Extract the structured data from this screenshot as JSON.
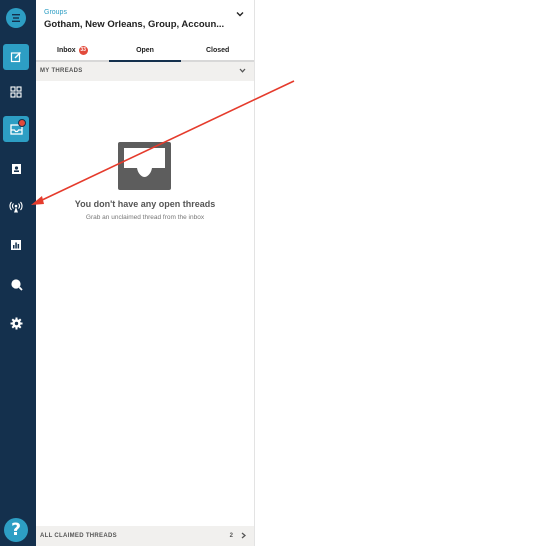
{
  "rail": {
    "items": [
      {
        "icon": "hamburger-icon",
        "active": false
      },
      {
        "icon": "compose-icon",
        "active": true
      },
      {
        "icon": "grid-icon",
        "active": false
      },
      {
        "icon": "inbox-icon",
        "active": true,
        "has_notification": true
      },
      {
        "icon": "contacts-icon",
        "active": false
      },
      {
        "icon": "broadcast-icon",
        "active": false
      },
      {
        "icon": "analytics-icon",
        "active": false
      },
      {
        "icon": "search-icon",
        "active": false
      },
      {
        "icon": "settings-icon",
        "active": false
      }
    ],
    "help_label": "?"
  },
  "header": {
    "label": "Groups",
    "title": "Gotham, New Orleans, Group, Accoun..."
  },
  "tabs": [
    {
      "label": "Inbox",
      "badge": "33",
      "active": false
    },
    {
      "label": "Open",
      "active": true
    },
    {
      "label": "Closed",
      "active": false
    }
  ],
  "my_threads": {
    "label": "MY THREADS"
  },
  "empty_state": {
    "title": "You don't have any open threads",
    "subtitle": "Grab an unclaimed thread from the inbox"
  },
  "footer": {
    "label": "ALL CLAIMED THREADS",
    "count": "2"
  },
  "colors": {
    "rail": "#14304d",
    "accent": "#2d9ec4",
    "badge": "#e24a3b",
    "annotation": "#e53b2c"
  }
}
